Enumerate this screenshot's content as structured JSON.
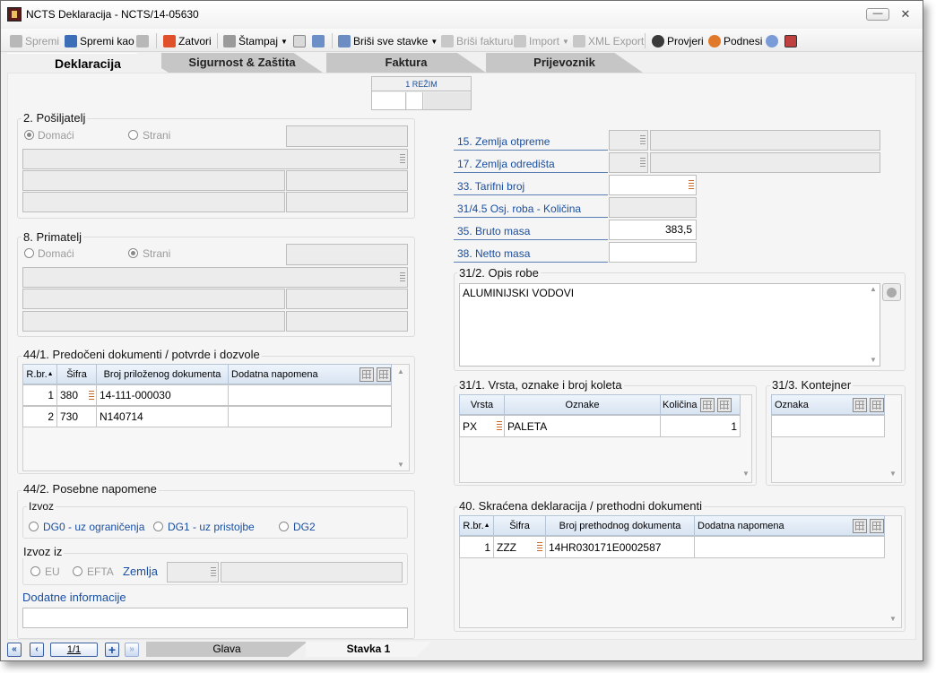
{
  "window": {
    "title": "NCTS Deklaracija - NCTS/14-05630"
  },
  "toolbar": {
    "spremi": "Spremi",
    "spremi_kao": "Spremi kao",
    "zatvori": "Zatvori",
    "stampaj": "Štampaj",
    "brisi_sve_stavke": "Briši sve stavke",
    "brisi_fakturu": "Briši fakturu",
    "import": "Import",
    "xml_export": "XML Export",
    "provjeri": "Provjeri",
    "podnesi": "Podnesi"
  },
  "tabs": [
    "Deklaracija",
    "Sigurnost & Zaštita",
    "Faktura",
    "Prijevoznik"
  ],
  "rezim": {
    "label": "1 REŽIM"
  },
  "posiljatelj": {
    "title": "2. Pošiljatelj",
    "domaci": "Domaći",
    "strani": "Strani"
  },
  "primatelj": {
    "title": "8. Primatelj",
    "domaci": "Domaći",
    "strani": "Strani"
  },
  "right_fields": {
    "zemlja_otpreme": "15. Zemlja otpreme",
    "zemlja_odredista": "17. Zemlja odredišta",
    "tarifni_broj": "33. Tarifni broj",
    "osj_roba": "31/4.5  Osj. roba - Količina",
    "bruto_masa": "35. Bruto masa",
    "bruto_masa_value": "383,5",
    "netto_masa": "38. Netto masa"
  },
  "opis_robe": {
    "title": "31/2. Opis robe",
    "text": "ALUMINIJSKI VODOVI"
  },
  "predoceni": {
    "title": "44/1. Predočeni dokumenti / potvrde i dozvole",
    "headers": [
      "R.br.",
      "Šifra",
      "Broj priloženog dokumenta",
      "Dodatna napomena"
    ],
    "rows": [
      {
        "rbr": "1",
        "sifra": "380",
        "broj": "14-111-000030",
        "napomena": ""
      },
      {
        "rbr": "2",
        "sifra": "730",
        "broj": "N140714",
        "napomena": ""
      }
    ]
  },
  "koleti": {
    "title": "31/1. Vrsta, oznake i broj koleta",
    "headers": [
      "Vrsta",
      "Oznake",
      "Količina"
    ],
    "rows": [
      {
        "vrsta": "PX",
        "oznake": "PALETA",
        "kolicina": "1"
      }
    ]
  },
  "kontejner": {
    "title": "31/3. Kontejner",
    "headers": [
      "Oznaka"
    ]
  },
  "posebne": {
    "title": "44/2. Posebne napomene",
    "izvoz": "Izvoz",
    "dg0": "DG0 - uz ograničenja",
    "dg1": "DG1 - uz pristojbe",
    "dg2": "DG2",
    "izvoz_iz": "Izvoz iz",
    "eu": "EU",
    "efta": "EFTA",
    "zemlja": "Zemlja",
    "dodatne": "Dodatne informacije"
  },
  "skracena": {
    "title": "40. Skraćena deklaracija / prethodni dokumenti",
    "headers": [
      "R.br.",
      "Šifra",
      "Broj prethodnog dokumenta",
      "Dodatna napomena"
    ],
    "rows": [
      {
        "rbr": "1",
        "sifra": "ZZZ",
        "broj": "14HR030171E0002587",
        "napomena": ""
      }
    ]
  },
  "navigation": {
    "pager": "1/1",
    "tab_glava": "Glava",
    "tab_stavka": "Stavka 1"
  }
}
